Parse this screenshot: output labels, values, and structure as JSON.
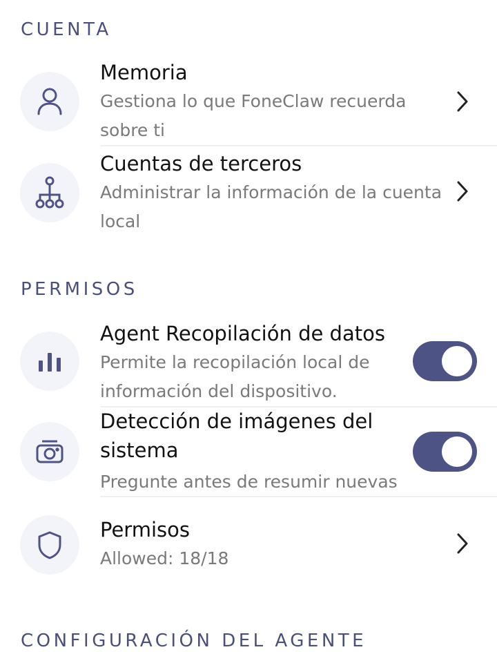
{
  "sections": {
    "account": {
      "header": "CUENTA",
      "items": [
        {
          "title": "Memoria",
          "subtitle": "Gestiona lo que FoneClaw recuerda sobre ti",
          "icon": "person-icon"
        },
        {
          "title": "Cuentas de terceros",
          "subtitle": "Administrar la información de la cuenta local",
          "icon": "hierarchy-icon"
        }
      ]
    },
    "permissions": {
      "header": "PERMISOS",
      "items": [
        {
          "title": "Agent Recopilación de datos",
          "subtitle": "Permite la recopilación local de información del dispositivo.",
          "icon": "bar-chart-icon",
          "toggle_on": true
        },
        {
          "title": "Detección de imágenes del sistema",
          "subtitle": "Pregunte antes de resumir nuevas",
          "icon": "camera-icon",
          "toggle_on": true
        },
        {
          "title": "Permisos",
          "subtitle": "Allowed: 18/18",
          "icon": "shield-icon"
        }
      ]
    },
    "agent_config": {
      "header": "CONFIGURACIÓN DEL AGENTE"
    }
  },
  "colors": {
    "accent": "#4e5386",
    "header_text": "#4a4f7c",
    "icon_bg": "#f3f4fa",
    "subtitle": "#7a7a7a"
  }
}
